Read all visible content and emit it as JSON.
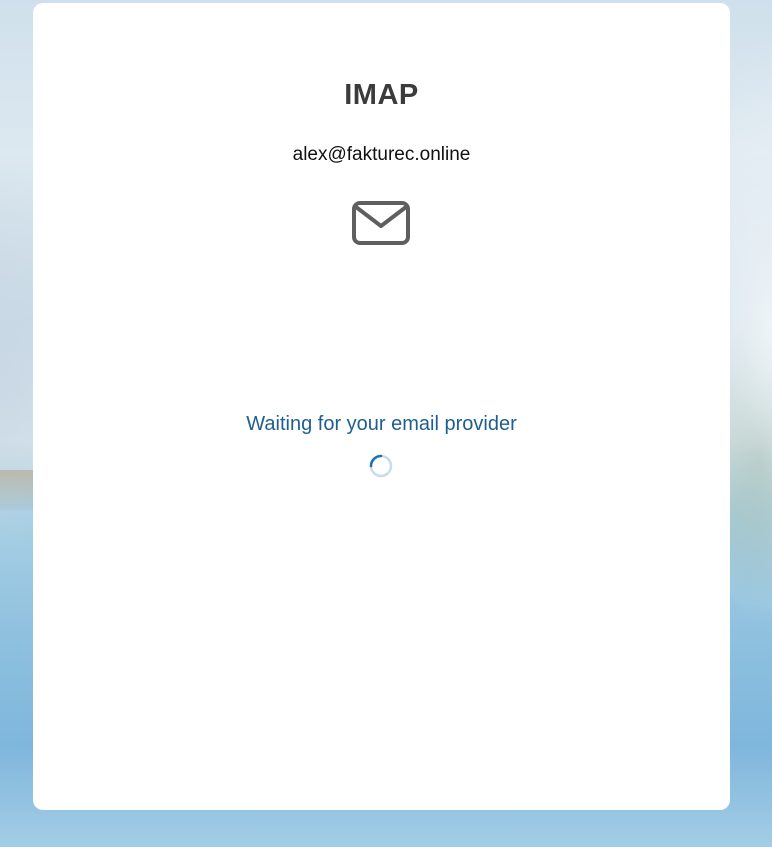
{
  "dialog": {
    "title": "IMAP",
    "email": "alex@fakturec.online",
    "icon": "envelope-icon",
    "status_text": "Waiting for your email provider",
    "loading_indicator": "spinner-icon"
  },
  "colors": {
    "card_background": "#ffffff",
    "title_color": "#3b3b3b",
    "status_color": "#1f5f8f",
    "spinner_color": "#1f6fb2"
  }
}
